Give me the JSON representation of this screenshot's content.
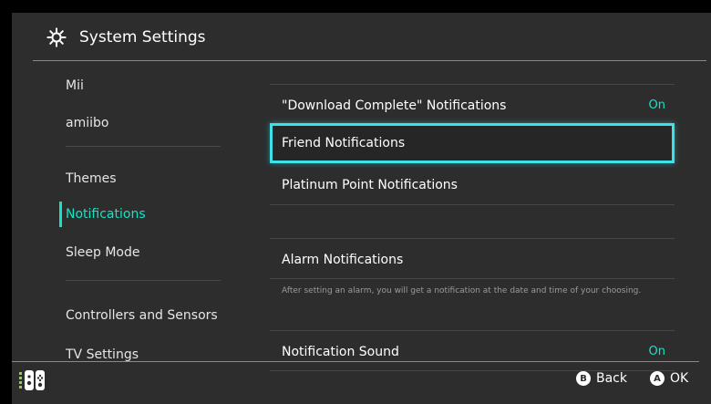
{
  "header": {
    "title": "System Settings",
    "icon": "gear-icon"
  },
  "sidebar": {
    "items": [
      {
        "label": "Mii"
      },
      {
        "label": "amiibo"
      },
      {
        "label": "Themes"
      },
      {
        "label": "Notifications",
        "active": true
      },
      {
        "label": "Sleep Mode"
      },
      {
        "label": "Controllers and Sensors"
      },
      {
        "label": "TV Settings"
      }
    ]
  },
  "main": {
    "rows": [
      {
        "label": "\"Download Complete\" Notifications",
        "value": "On"
      },
      {
        "label": "Friend Notifications",
        "selected": true
      },
      {
        "label": "Platinum Point Notifications"
      },
      {
        "label": "Alarm Notifications"
      },
      {
        "label": "Notification Sound",
        "value": "On"
      }
    ],
    "alarm_description": "After setting an alarm, you will get a notification at the date and time of your choosing."
  },
  "footer": {
    "back_key": "B",
    "back_label": "Back",
    "ok_key": "A",
    "ok_label": "OK",
    "controller_icon": "joy-con-icon"
  },
  "colors": {
    "accent": "#16e3c3",
    "selection_border": "#3fe0e8",
    "panel_bg": "#2d2d2d"
  }
}
